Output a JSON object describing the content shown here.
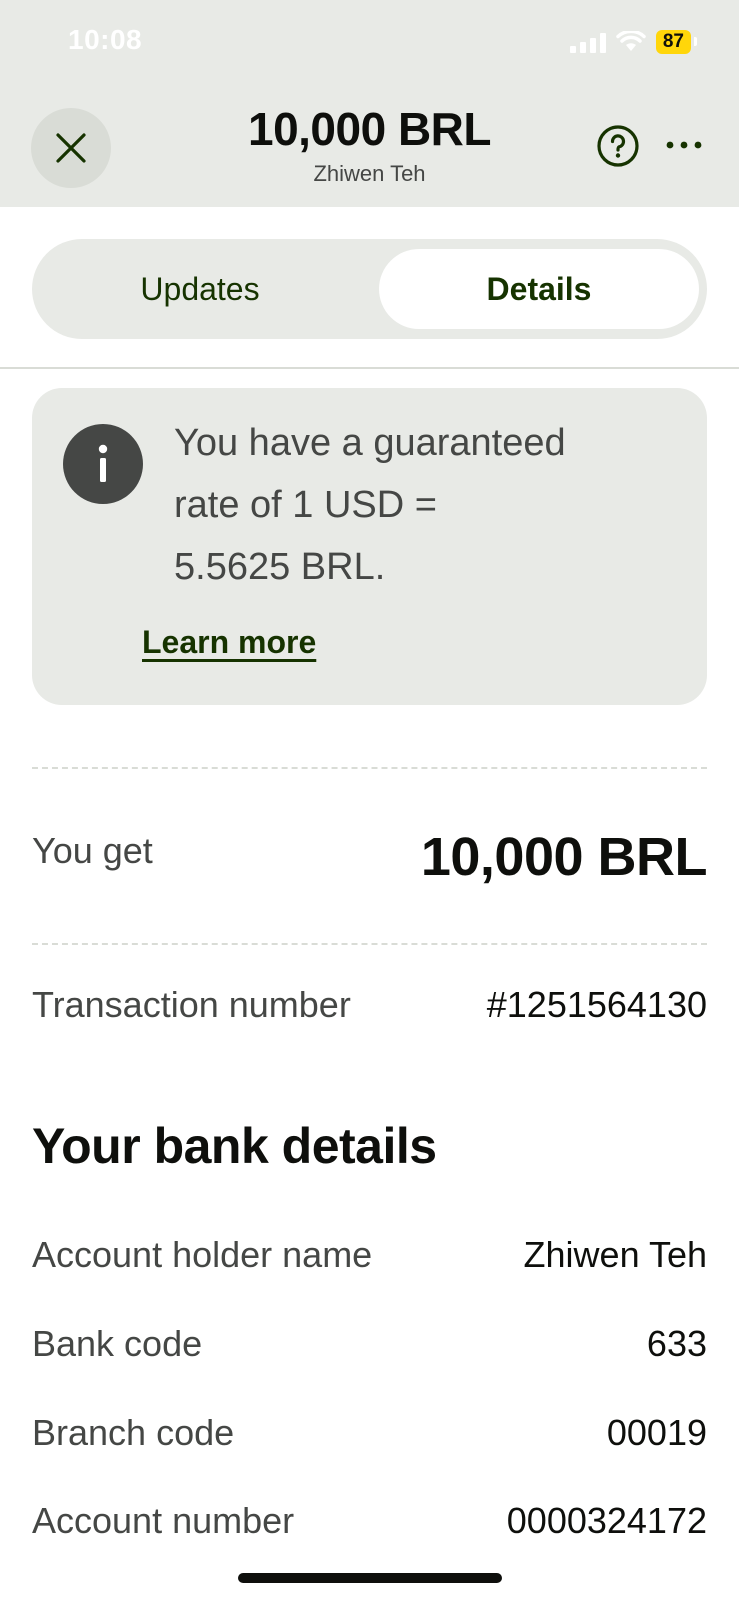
{
  "status_bar": {
    "time": "10:08",
    "battery": "87"
  },
  "header": {
    "title": "10,000 BRL",
    "subtitle": "Zhiwen Teh"
  },
  "tabs": [
    {
      "label": "Updates",
      "selected": false
    },
    {
      "label": "Details",
      "selected": true
    }
  ],
  "info_card": {
    "line1": "You have a guaranteed",
    "line2": "rate of 1 USD =",
    "line3": "5.5625 BRL.",
    "link": "Learn more"
  },
  "summary": {
    "you_get_label": "You get",
    "you_get_value": "10,000 BRL",
    "transaction_label": "Transaction number",
    "transaction_value": "#1251564130"
  },
  "bank_details": {
    "title": "Your bank details",
    "rows": [
      {
        "label": "Account holder name",
        "value": "Zhiwen Teh"
      },
      {
        "label": "Bank code",
        "value": "633"
      },
      {
        "label": "Branch code",
        "value": "00019"
      },
      {
        "label": "Account number",
        "value": "0000324172"
      }
    ]
  },
  "colors": {
    "header_bg": "#e8eae6",
    "primary_text": "#0e0f0c",
    "secondary_text": "#454745",
    "accent_green": "#163300",
    "battery": "#ffd60a"
  }
}
